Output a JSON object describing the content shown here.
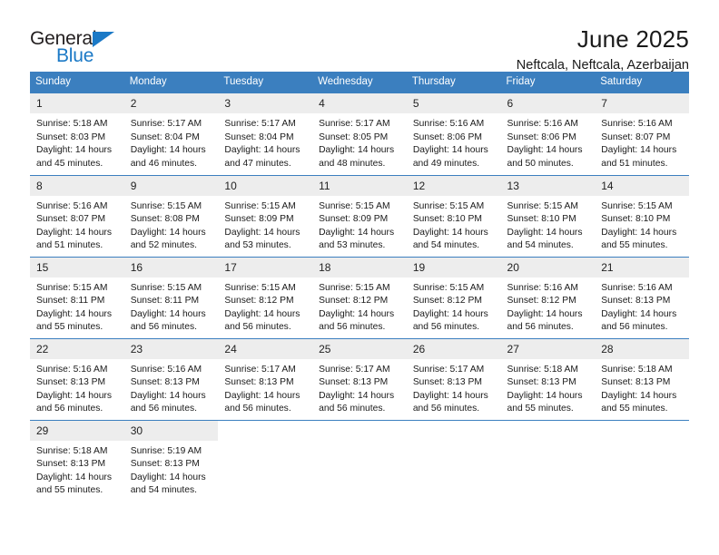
{
  "brand": {
    "name_part1": "General",
    "name_part2": "Blue",
    "triangle_color": "#1b79c6"
  },
  "header": {
    "title": "June 2025",
    "subtitle": "Neftcala, Neftcala, Azerbaijan"
  },
  "theme": {
    "header_bg": "#3b7fbf",
    "daynum_bg": "#ededed",
    "rule_color": "#3b7fbf"
  },
  "weekday_headers": [
    "Sunday",
    "Monday",
    "Tuesday",
    "Wednesday",
    "Thursday",
    "Friday",
    "Saturday"
  ],
  "weeks": [
    [
      {
        "day": "1",
        "sunrise": "Sunrise: 5:18 AM",
        "sunset": "Sunset: 8:03 PM",
        "daylight1": "Daylight: 14 hours",
        "daylight2": "and 45 minutes."
      },
      {
        "day": "2",
        "sunrise": "Sunrise: 5:17 AM",
        "sunset": "Sunset: 8:04 PM",
        "daylight1": "Daylight: 14 hours",
        "daylight2": "and 46 minutes."
      },
      {
        "day": "3",
        "sunrise": "Sunrise: 5:17 AM",
        "sunset": "Sunset: 8:04 PM",
        "daylight1": "Daylight: 14 hours",
        "daylight2": "and 47 minutes."
      },
      {
        "day": "4",
        "sunrise": "Sunrise: 5:17 AM",
        "sunset": "Sunset: 8:05 PM",
        "daylight1": "Daylight: 14 hours",
        "daylight2": "and 48 minutes."
      },
      {
        "day": "5",
        "sunrise": "Sunrise: 5:16 AM",
        "sunset": "Sunset: 8:06 PM",
        "daylight1": "Daylight: 14 hours",
        "daylight2": "and 49 minutes."
      },
      {
        "day": "6",
        "sunrise": "Sunrise: 5:16 AM",
        "sunset": "Sunset: 8:06 PM",
        "daylight1": "Daylight: 14 hours",
        "daylight2": "and 50 minutes."
      },
      {
        "day": "7",
        "sunrise": "Sunrise: 5:16 AM",
        "sunset": "Sunset: 8:07 PM",
        "daylight1": "Daylight: 14 hours",
        "daylight2": "and 51 minutes."
      }
    ],
    [
      {
        "day": "8",
        "sunrise": "Sunrise: 5:16 AM",
        "sunset": "Sunset: 8:07 PM",
        "daylight1": "Daylight: 14 hours",
        "daylight2": "and 51 minutes."
      },
      {
        "day": "9",
        "sunrise": "Sunrise: 5:15 AM",
        "sunset": "Sunset: 8:08 PM",
        "daylight1": "Daylight: 14 hours",
        "daylight2": "and 52 minutes."
      },
      {
        "day": "10",
        "sunrise": "Sunrise: 5:15 AM",
        "sunset": "Sunset: 8:09 PM",
        "daylight1": "Daylight: 14 hours",
        "daylight2": "and 53 minutes."
      },
      {
        "day": "11",
        "sunrise": "Sunrise: 5:15 AM",
        "sunset": "Sunset: 8:09 PM",
        "daylight1": "Daylight: 14 hours",
        "daylight2": "and 53 minutes."
      },
      {
        "day": "12",
        "sunrise": "Sunrise: 5:15 AM",
        "sunset": "Sunset: 8:10 PM",
        "daylight1": "Daylight: 14 hours",
        "daylight2": "and 54 minutes."
      },
      {
        "day": "13",
        "sunrise": "Sunrise: 5:15 AM",
        "sunset": "Sunset: 8:10 PM",
        "daylight1": "Daylight: 14 hours",
        "daylight2": "and 54 minutes."
      },
      {
        "day": "14",
        "sunrise": "Sunrise: 5:15 AM",
        "sunset": "Sunset: 8:10 PM",
        "daylight1": "Daylight: 14 hours",
        "daylight2": "and 55 minutes."
      }
    ],
    [
      {
        "day": "15",
        "sunrise": "Sunrise: 5:15 AM",
        "sunset": "Sunset: 8:11 PM",
        "daylight1": "Daylight: 14 hours",
        "daylight2": "and 55 minutes."
      },
      {
        "day": "16",
        "sunrise": "Sunrise: 5:15 AM",
        "sunset": "Sunset: 8:11 PM",
        "daylight1": "Daylight: 14 hours",
        "daylight2": "and 56 minutes."
      },
      {
        "day": "17",
        "sunrise": "Sunrise: 5:15 AM",
        "sunset": "Sunset: 8:12 PM",
        "daylight1": "Daylight: 14 hours",
        "daylight2": "and 56 minutes."
      },
      {
        "day": "18",
        "sunrise": "Sunrise: 5:15 AM",
        "sunset": "Sunset: 8:12 PM",
        "daylight1": "Daylight: 14 hours",
        "daylight2": "and 56 minutes."
      },
      {
        "day": "19",
        "sunrise": "Sunrise: 5:15 AM",
        "sunset": "Sunset: 8:12 PM",
        "daylight1": "Daylight: 14 hours",
        "daylight2": "and 56 minutes."
      },
      {
        "day": "20",
        "sunrise": "Sunrise: 5:16 AM",
        "sunset": "Sunset: 8:12 PM",
        "daylight1": "Daylight: 14 hours",
        "daylight2": "and 56 minutes."
      },
      {
        "day": "21",
        "sunrise": "Sunrise: 5:16 AM",
        "sunset": "Sunset: 8:13 PM",
        "daylight1": "Daylight: 14 hours",
        "daylight2": "and 56 minutes."
      }
    ],
    [
      {
        "day": "22",
        "sunrise": "Sunrise: 5:16 AM",
        "sunset": "Sunset: 8:13 PM",
        "daylight1": "Daylight: 14 hours",
        "daylight2": "and 56 minutes."
      },
      {
        "day": "23",
        "sunrise": "Sunrise: 5:16 AM",
        "sunset": "Sunset: 8:13 PM",
        "daylight1": "Daylight: 14 hours",
        "daylight2": "and 56 minutes."
      },
      {
        "day": "24",
        "sunrise": "Sunrise: 5:17 AM",
        "sunset": "Sunset: 8:13 PM",
        "daylight1": "Daylight: 14 hours",
        "daylight2": "and 56 minutes."
      },
      {
        "day": "25",
        "sunrise": "Sunrise: 5:17 AM",
        "sunset": "Sunset: 8:13 PM",
        "daylight1": "Daylight: 14 hours",
        "daylight2": "and 56 minutes."
      },
      {
        "day": "26",
        "sunrise": "Sunrise: 5:17 AM",
        "sunset": "Sunset: 8:13 PM",
        "daylight1": "Daylight: 14 hours",
        "daylight2": "and 56 minutes."
      },
      {
        "day": "27",
        "sunrise": "Sunrise: 5:18 AM",
        "sunset": "Sunset: 8:13 PM",
        "daylight1": "Daylight: 14 hours",
        "daylight2": "and 55 minutes."
      },
      {
        "day": "28",
        "sunrise": "Sunrise: 5:18 AM",
        "sunset": "Sunset: 8:13 PM",
        "daylight1": "Daylight: 14 hours",
        "daylight2": "and 55 minutes."
      }
    ],
    [
      {
        "day": "29",
        "sunrise": "Sunrise: 5:18 AM",
        "sunset": "Sunset: 8:13 PM",
        "daylight1": "Daylight: 14 hours",
        "daylight2": "and 55 minutes."
      },
      {
        "day": "30",
        "sunrise": "Sunrise: 5:19 AM",
        "sunset": "Sunset: 8:13 PM",
        "daylight1": "Daylight: 14 hours",
        "daylight2": "and 54 minutes."
      },
      {
        "day": "",
        "sunrise": "",
        "sunset": "",
        "daylight1": "",
        "daylight2": ""
      },
      {
        "day": "",
        "sunrise": "",
        "sunset": "",
        "daylight1": "",
        "daylight2": ""
      },
      {
        "day": "",
        "sunrise": "",
        "sunset": "",
        "daylight1": "",
        "daylight2": ""
      },
      {
        "day": "",
        "sunrise": "",
        "sunset": "",
        "daylight1": "",
        "daylight2": ""
      },
      {
        "day": "",
        "sunrise": "",
        "sunset": "",
        "daylight1": "",
        "daylight2": ""
      }
    ]
  ]
}
